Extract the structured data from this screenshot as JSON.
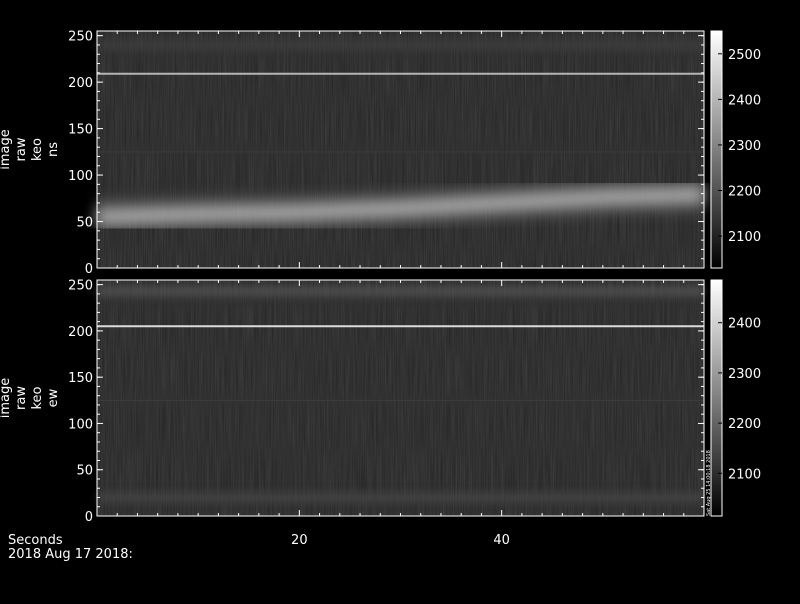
{
  "chart_data": [
    {
      "type": "heatmap",
      "ylabel_lines": [
        "image",
        "raw",
        "keo",
        "ns"
      ],
      "ylim": [
        0,
        255
      ],
      "yticks": [
        0,
        50,
        100,
        150,
        200,
        250
      ],
      "xlim": [
        0,
        60
      ],
      "colorbar": {
        "range": [
          2030,
          2550
        ],
        "ticks": [
          2100,
          2200,
          2300,
          2400,
          2500
        ]
      },
      "features": [
        {
          "kind": "horizontal_line",
          "y": 209,
          "value": 2400
        },
        {
          "kind": "horizontal_line",
          "y": 125,
          "value": 2150
        },
        {
          "kind": "band",
          "y": 240,
          "value": 2170
        },
        {
          "kind": "arc",
          "points": [
            [
              0,
              55
            ],
            [
              10,
              58
            ],
            [
              20,
              60
            ],
            [
              30,
              64
            ],
            [
              40,
              70
            ],
            [
              50,
              76
            ],
            [
              60,
              79
            ]
          ],
          "value": 2450
        }
      ]
    },
    {
      "type": "heatmap",
      "ylabel_lines": [
        "image",
        "raw",
        "keo",
        "ew"
      ],
      "ylim": [
        0,
        255
      ],
      "yticks": [
        0,
        50,
        100,
        150,
        200,
        250
      ],
      "xlim": [
        0,
        60
      ],
      "colorbar": {
        "range": [
          2015,
          2485
        ],
        "ticks": [
          2100,
          2200,
          2300,
          2400
        ]
      },
      "features": [
        {
          "kind": "horizontal_line",
          "y": 205,
          "value": 2420
        },
        {
          "kind": "horizontal_line",
          "y": 125,
          "value": 2130
        },
        {
          "kind": "band",
          "y": 243,
          "value": 2200
        },
        {
          "kind": "band",
          "y": 20,
          "value": 2160
        }
      ]
    }
  ],
  "x_axis": {
    "label": "Seconds",
    "date_line": "2018 Aug 17 2018:",
    "ticks": [
      20,
      40
    ]
  },
  "stamp": "Sat Aug 25 14:00:18 2018"
}
